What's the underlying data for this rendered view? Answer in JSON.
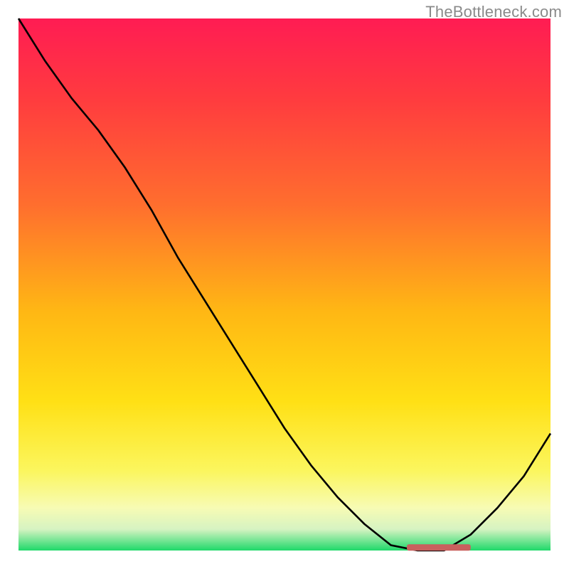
{
  "watermark": "TheBottleneck.com",
  "chart_data": {
    "type": "line",
    "title": "",
    "xlabel": "",
    "ylabel": "",
    "xlim": [
      0,
      100
    ],
    "ylim": [
      0,
      100
    ],
    "grid": false,
    "series": [
      {
        "name": "bottleneck-curve",
        "x": [
          0,
          5,
          10,
          15,
          20,
          25,
          30,
          35,
          40,
          45,
          50,
          55,
          60,
          65,
          70,
          75,
          80,
          85,
          90,
          95,
          100
        ],
        "values": [
          100,
          92,
          85,
          79,
          72,
          64,
          55,
          47,
          39,
          31,
          23,
          16,
          10,
          5,
          1,
          0,
          0,
          3,
          8,
          14,
          22
        ]
      }
    ],
    "marker": {
      "name": "optimal-range",
      "x_start": 73,
      "x_end": 85,
      "y": 0.5,
      "color": "#c9615e"
    },
    "gradient_stops": [
      {
        "offset": 0.0,
        "color": "#ff1c53"
      },
      {
        "offset": 0.15,
        "color": "#ff3b3f"
      },
      {
        "offset": 0.35,
        "color": "#ff6e2e"
      },
      {
        "offset": 0.55,
        "color": "#ffb714"
      },
      {
        "offset": 0.72,
        "color": "#ffe015"
      },
      {
        "offset": 0.85,
        "color": "#fbf65e"
      },
      {
        "offset": 0.92,
        "color": "#f7fbb4"
      },
      {
        "offset": 0.96,
        "color": "#d6f3c2"
      },
      {
        "offset": 1.0,
        "color": "#1fd96a"
      }
    ]
  }
}
